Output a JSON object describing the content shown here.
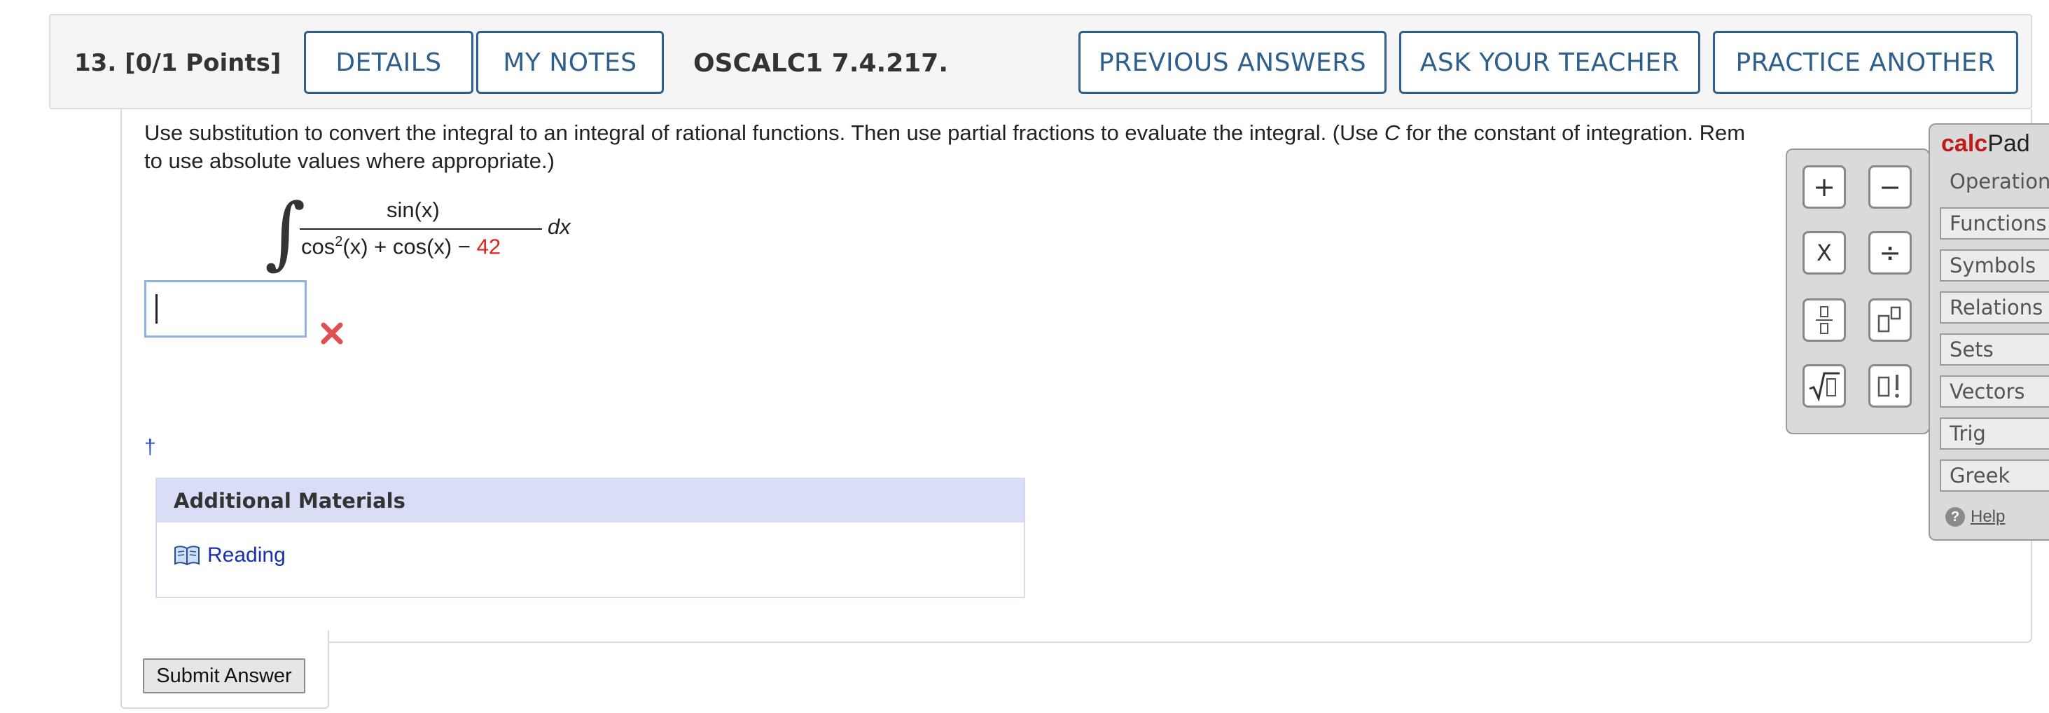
{
  "header": {
    "question_number": "13.",
    "points": "[0/1 Points]",
    "details_label": "DETAILS",
    "my_notes_label": "MY NOTES",
    "problem_code": "OSCALC1 7.4.217.",
    "previous_answers_label": "PREVIOUS ANSWERS",
    "ask_teacher_label": "ASK YOUR TEACHER",
    "practice_another_label": "PRACTICE ANOTHER"
  },
  "question": {
    "prompt_line1_a": "Use substitution to convert the integral to an integral of rational functions. Then use partial fractions to evaluate the integral. (Use ",
    "prompt_var": "C",
    "prompt_line1_b": " for the constant of integration. Rem",
    "prompt_line2": "to use absolute values where appropriate.)",
    "integral_sign": "∫",
    "numerator": "sin(x)",
    "denominator_a": "cos",
    "denominator_exp": "2",
    "denominator_b": "(x) + cos(x) − ",
    "denominator_const": "42",
    "differential": "dx",
    "answer_value": "",
    "dagger": "†"
  },
  "materials": {
    "heading": "Additional Materials",
    "reading_label": "Reading"
  },
  "submit_label": "Submit Answer",
  "calcpad": {
    "title_a": "calc",
    "title_b": "Pad",
    "keys": [
      "+",
      "−",
      "X",
      "÷",
      "▯/▯",
      "▯▯",
      "√▯",
      "▯!"
    ],
    "tabs": [
      "Operations",
      "Functions",
      "Symbols",
      "Relations",
      "Sets",
      "Vectors",
      "Trig",
      "Greek"
    ],
    "help_label": "Help"
  },
  "colors": {
    "accent_blue": "#2f5f8c",
    "error_red": "#e0231d",
    "link_blue": "#1a2fb0",
    "materials_header_bg": "#d9def6"
  }
}
